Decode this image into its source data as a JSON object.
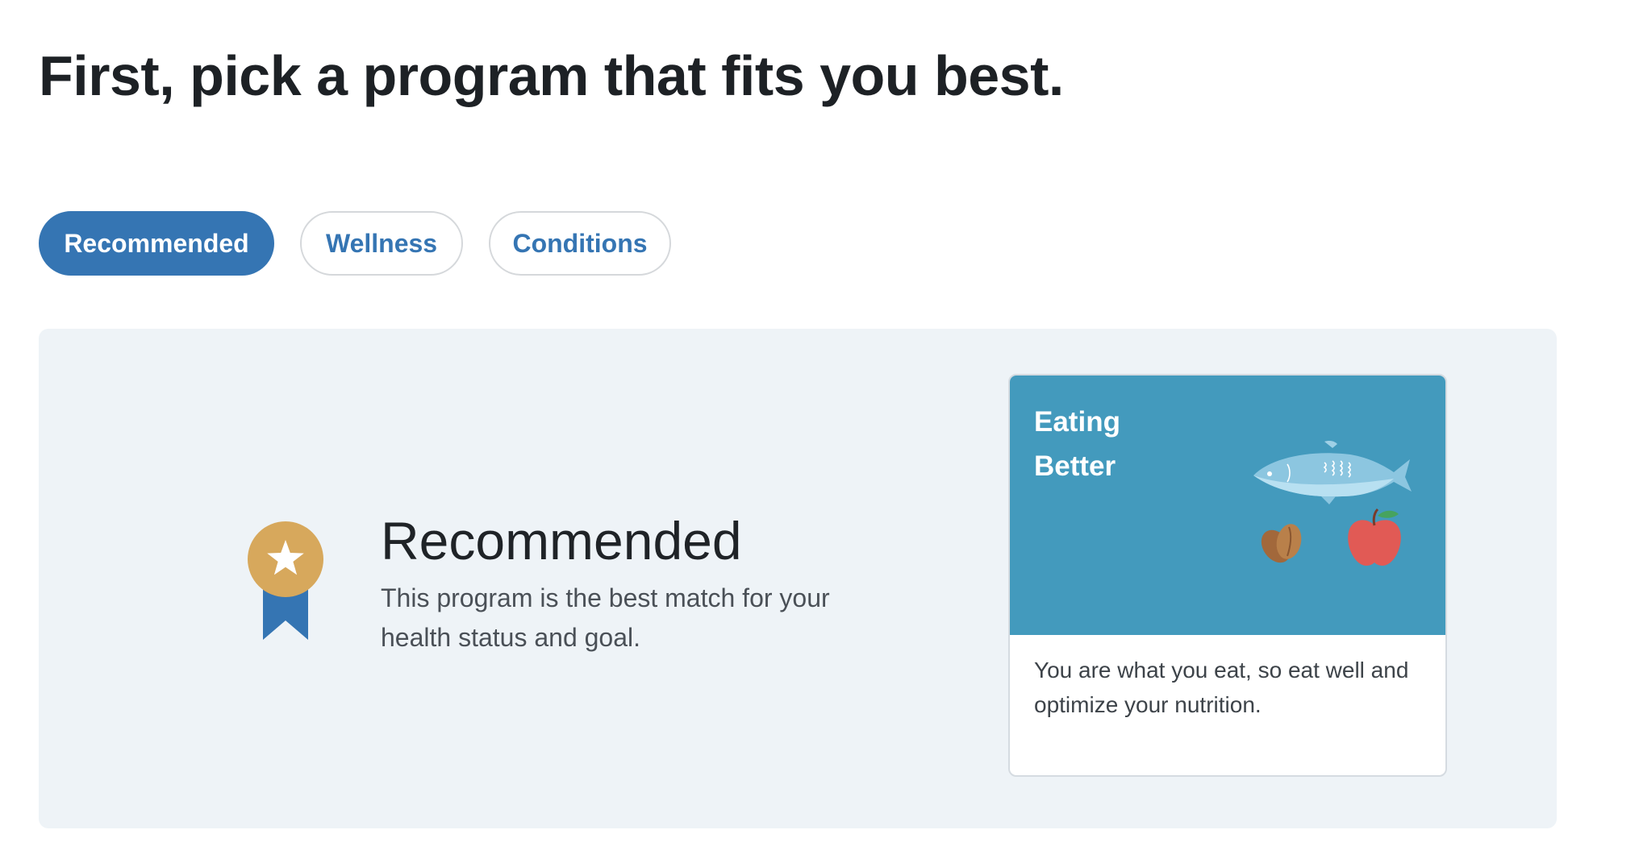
{
  "header": {
    "title": "First, pick a program that fits you best."
  },
  "tabs": [
    {
      "label": "Recommended",
      "active": true
    },
    {
      "label": "Wellness",
      "active": false
    },
    {
      "label": "Conditions",
      "active": false
    }
  ],
  "recommended": {
    "title": "Recommended",
    "description": "This program is the best match for your health status and goal.",
    "icon": "award-ribbon-icon"
  },
  "program_card": {
    "title": "Eating Better",
    "description": "You are what you eat, so eat well and optimize your nutrition.",
    "illustration_icons": [
      "fish-icon",
      "almond-icon",
      "apple-icon"
    ]
  },
  "colors": {
    "accent": "#3575b3",
    "panel_background": "#eef3f7",
    "card_image_background": "#439abd",
    "badge_gold": "#d7a85c"
  }
}
